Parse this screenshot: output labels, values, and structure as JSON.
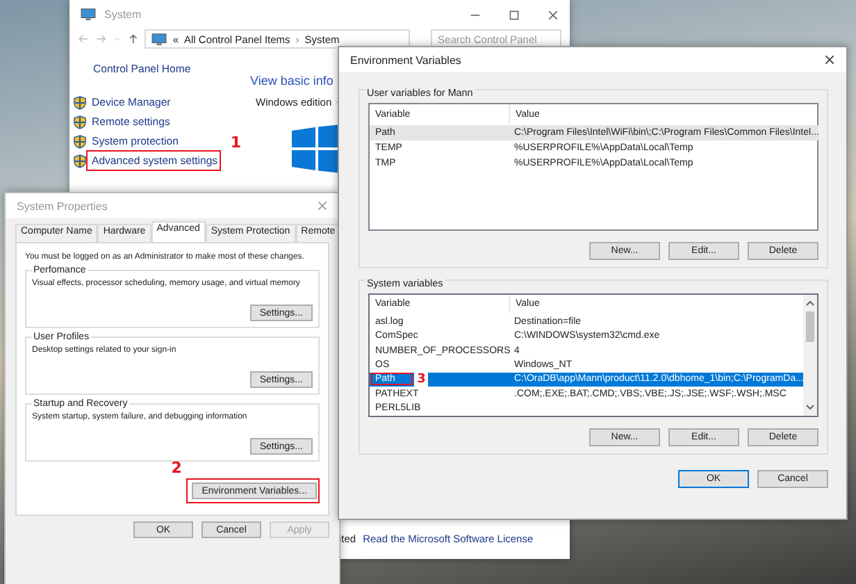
{
  "system_window": {
    "title": "System",
    "breadcrumb": {
      "overflow": "«",
      "parent": "All Control Panel Items",
      "separator": "›",
      "current": "System"
    },
    "search": {
      "placeholder": "Search Control Panel"
    },
    "home_link": "Control Panel Home",
    "tasks": [
      {
        "label": "Device Manager"
      },
      {
        "label": "Remote settings"
      },
      {
        "label": "System protection"
      },
      {
        "label": "Advanced system settings",
        "callout": "1"
      }
    ],
    "heading": "View basic info",
    "section": "Windows edition",
    "footer": {
      "fragment": "ited",
      "link": "Read the Microsoft Software License"
    }
  },
  "system_properties": {
    "title": "System Properties",
    "tabs": [
      {
        "label": "Computer Name",
        "selected": false
      },
      {
        "label": "Hardware",
        "selected": false
      },
      {
        "label": "Advanced",
        "selected": true
      },
      {
        "label": "System Protection",
        "selected": false
      },
      {
        "label": "Remote",
        "selected": false
      }
    ],
    "notice": "You must be logged on as an Administrator to make most of these changes.",
    "groups": [
      {
        "title": "Perfomance",
        "description": "Visual effects, processor scheduling, memory usage, and virtual memory",
        "button": "Settings..."
      },
      {
        "title": "User Profiles",
        "description": "Desktop settings related to your sign-in",
        "button": "Settings..."
      },
      {
        "title": "Startup and Recovery",
        "description": "System startup, system failure, and debugging information",
        "button": "Settings..."
      }
    ],
    "environment_button": {
      "label": "Environment Variables...",
      "callout": "2"
    },
    "buttons": [
      {
        "label": "OK",
        "disabled": false
      },
      {
        "label": "Cancel",
        "disabled": false
      },
      {
        "label": "Apply",
        "disabled": true
      }
    ]
  },
  "environment_variables": {
    "title": "Environment Variables",
    "user_variables": {
      "title": "User variables for Mann",
      "focused": false,
      "columns": [
        "Variable",
        "Value"
      ],
      "rows": [
        {
          "variable": "Path",
          "value": "C:\\Program Files\\Intel\\WiFi\\bin\\;C:\\Program Files\\Common Files\\Intel...",
          "selected": true
        },
        {
          "variable": "TEMP",
          "value": "%USERPROFILE%\\AppData\\Local\\Temp",
          "selected": false
        },
        {
          "variable": "TMP",
          "value": "%USERPROFILE%\\AppData\\Local\\Temp",
          "selected": false
        }
      ],
      "buttons": [
        "New...",
        "Edit...",
        "Delete"
      ]
    },
    "system_variables": {
      "title": "System variables",
      "focused": true,
      "columns": [
        "Variable",
        "Value"
      ],
      "rows": [
        {
          "variable": "asl.log",
          "value": "Destination=file",
          "selected": false
        },
        {
          "variable": "ComSpec",
          "value": "C:\\WINDOWS\\system32\\cmd.exe",
          "selected": false
        },
        {
          "variable": "NUMBER_OF_PROCESSORS",
          "value": "4",
          "selected": false
        },
        {
          "variable": "OS",
          "value": "Windows_NT",
          "selected": false
        },
        {
          "variable": "Path",
          "value": "C:\\OraDB\\app\\Mann\\product\\11.2.0\\dbhome_1\\bin;C:\\ProgramDa...",
          "selected": true,
          "callout": "3"
        },
        {
          "variable": "PATHEXT",
          "value": ".COM;.EXE;.BAT;.CMD;.VBS;.VBE;.JS;.JSE;.WSF;.WSH;.MSC",
          "selected": false
        },
        {
          "variable": "PERL5LIB",
          "selected": false
        }
      ],
      "buttons": [
        "New...",
        "Edit...",
        "Delete"
      ]
    },
    "buttons": [
      {
        "label": "OK",
        "default": true
      },
      {
        "label": "Cancel",
        "default": false
      }
    ]
  }
}
